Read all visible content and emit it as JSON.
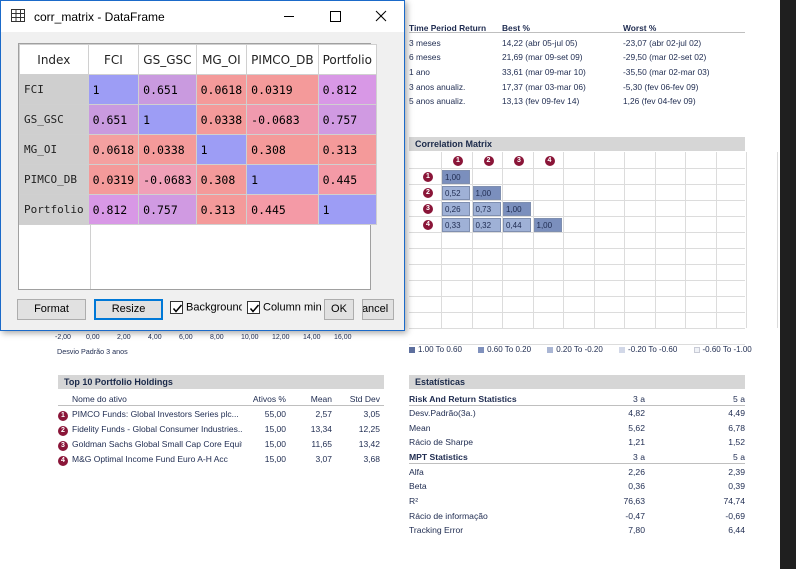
{
  "window": {
    "title": "corr_matrix - DataFrame",
    "columns": [
      "Index",
      "FCI",
      "GS_GSC",
      "MG_OI",
      "PIMCO_DB",
      "Portfolio"
    ],
    "rows": [
      {
        "label": "FCI",
        "cells": [
          "1",
          "0.651",
          "0.0618",
          "0.0319",
          "0.812"
        ]
      },
      {
        "label": "GS_GSC",
        "cells": [
          "0.651",
          "1",
          "0.0338",
          "-0.0683",
          "0.757"
        ]
      },
      {
        "label": "MG_OI",
        "cells": [
          "0.0618",
          "0.0338",
          "1",
          "0.308",
          "0.313"
        ]
      },
      {
        "label": "PIMCO_DB",
        "cells": [
          "0.0319",
          "-0.0683",
          "0.308",
          "1",
          "0.445"
        ]
      },
      {
        "label": "Portfolio",
        "cells": [
          "0.812",
          "0.757",
          "0.313",
          "0.445",
          "1"
        ]
      }
    ],
    "cell_colors": [
      [
        "#9d9df5",
        "#c99adf",
        "#f49a9a",
        "#f49a9a",
        "#d898e6"
      ],
      [
        "#c99adf",
        "#9d9df5",
        "#f49a9a",
        "#f09aae",
        "#d09ae2"
      ],
      [
        "#f4a0a0",
        "#f49a9a",
        "#9d9df5",
        "#f49a9a",
        "#f49a9a"
      ],
      [
        "#f49a9a",
        "#f0a0b8",
        "#f49a9a",
        "#9d9df5",
        "#f49aa6"
      ],
      [
        "#d898e6",
        "#d09ae2",
        "#f49a9a",
        "#f49aa6",
        "#9d9df5"
      ]
    ],
    "buttons": {
      "format": "Format",
      "resize": "Resize",
      "ok": "OK",
      "cancel": "Cancel"
    },
    "checkboxes": {
      "background": "Background color",
      "column_min_max": "Column min/max"
    }
  },
  "report": {
    "time_period": {
      "headers": [
        "Time Period Return",
        "Best %",
        "Worst %"
      ],
      "rows": [
        [
          "3 meses",
          "14,22 (abr 05-jul 05)",
          "-23,07 (abr 02-jul 02)"
        ],
        [
          "6 meses",
          "21,69 (mar 09-set 09)",
          "-29,50 (mar 02-set 02)"
        ],
        [
          "1 ano",
          "33,61 (mar 09-mar 10)",
          "-35,50 (mar 02-mar 03)"
        ],
        [
          "3 anos anualiz.",
          "17,37 (mar 03-mar 06)",
          "-5,30 (fev 06-fev 09)"
        ],
        [
          "5 anos anualiz.",
          "13,13 (fev 09-fev 14)",
          "1,26 (fev 04-fev 09)"
        ]
      ]
    },
    "correlation": {
      "title": "Correlation Matrix",
      "badges": [
        "1",
        "2",
        "3",
        "4"
      ],
      "values": [
        [
          "1,00"
        ],
        [
          "0,52",
          "1,00"
        ],
        [
          "0,26",
          "0,73",
          "1,00"
        ],
        [
          "0,33",
          "0,32",
          "0,44",
          "1,00"
        ]
      ],
      "legend": [
        "1.00 To 0.60",
        "0.60 To 0.20",
        "0.20 To -0.20",
        "-0.20 To -0.60",
        "-0.60 To -1.00"
      ],
      "legend_colors": [
        "#5d6f9e",
        "#8091bd",
        "#aab6d4",
        "#d2d8e8",
        "#f0f2f7"
      ]
    },
    "scatter_axis": {
      "ticks": [
        "-2,00",
        "0,00",
        "2,00",
        "4,00",
        "6,00",
        "8,00",
        "10,00",
        "12,00",
        "14,00",
        "16,00"
      ],
      "label": "Desvio Padrão 3 anos"
    },
    "holdings": {
      "title": "Top 10 Portfolio Holdings",
      "headers": [
        "Nome do ativo",
        "Ativos %",
        "Mean",
        "Std Dev"
      ],
      "rows": [
        [
          "PIMCO Funds: Global Investors Series plc...",
          "55,00",
          "2,57",
          "3,05"
        ],
        [
          "Fidelity Funds - Global Consumer Industries...",
          "15,00",
          "13,34",
          "12,25"
        ],
        [
          "Goldman Sachs Global Small Cap Core Equity...",
          "15,00",
          "11,65",
          "13,42"
        ],
        [
          "M&G Optimal Income Fund Euro A-H Acc",
          "15,00",
          "3,07",
          "3,68"
        ]
      ]
    },
    "statistics": {
      "title": "Estatísticas",
      "risk_header": [
        "Risk And Return Statistics",
        "3 a",
        "5 a"
      ],
      "risk_rows": [
        [
          "Desv.Padrão(3a.)",
          "4,82",
          "4,49"
        ],
        [
          "Mean",
          "5,62",
          "6,78"
        ],
        [
          "Rácio de Sharpe",
          "1,21",
          "1,52"
        ]
      ],
      "mpt_header": [
        "MPT Statistics",
        "3 a",
        "5 a"
      ],
      "mpt_rows": [
        [
          "Alfa",
          "2,26",
          "2,39"
        ],
        [
          "Beta",
          "0,36",
          "0,39"
        ],
        [
          "R²",
          "76,63",
          "74,74"
        ],
        [
          "Rácio de informação",
          "-0,47",
          "-0,69"
        ],
        [
          "Tracking Error",
          "7,80",
          "6,44"
        ]
      ]
    }
  }
}
